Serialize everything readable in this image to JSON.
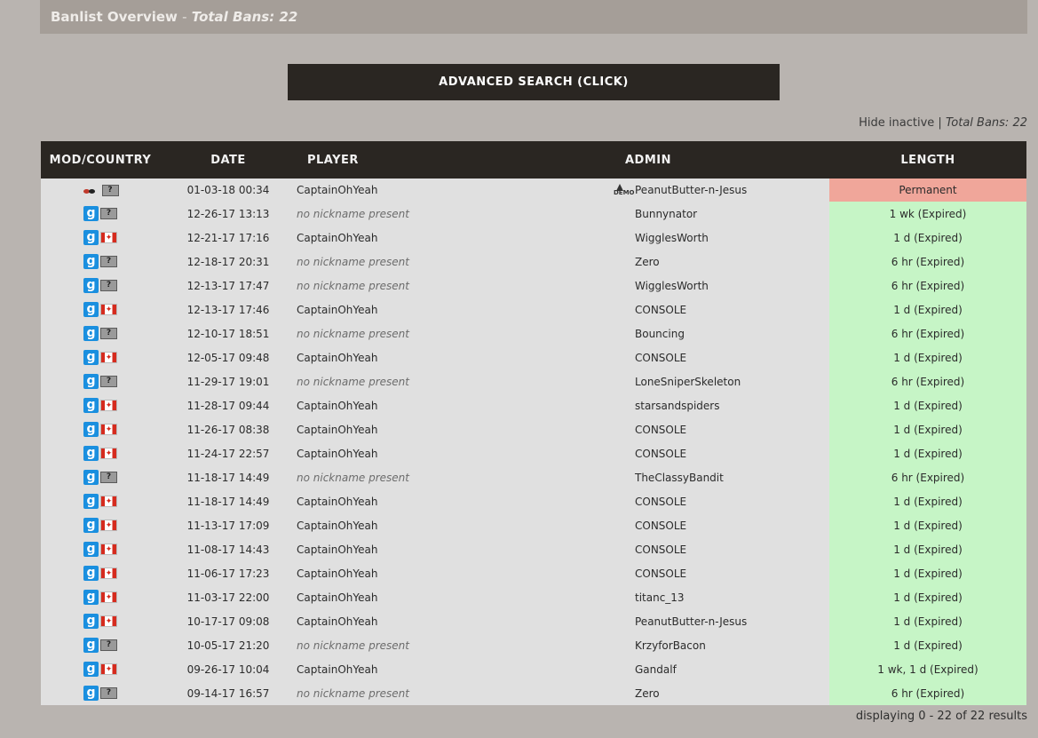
{
  "header": {
    "title": "Banlist Overview",
    "separator": "-",
    "total_label": "Total Bans: 22"
  },
  "advanced_search_label": "ADVANCED SEARCH (CLICK)",
  "filter": {
    "hide_inactive": "Hide inactive",
    "divider": "|",
    "total_label": "Total Bans: 22"
  },
  "columns": {
    "mod_country": "MOD/COUNTRY",
    "date": "DATE",
    "player": "PLAYER",
    "admin": "ADMIN",
    "length": "LENGTH"
  },
  "rows": [
    {
      "mod": "gamemode-icon",
      "country": "unknown",
      "date": "01-03-18 00:34",
      "player": "CaptainOhYeah",
      "admin": "PeanutButter-n-Jesus",
      "admin_icon": "demo-icon",
      "length": "Permanent",
      "status": "active"
    },
    {
      "mod": "gmod",
      "country": "unknown",
      "date": "12-26-17 13:13",
      "player": "no nickname present",
      "admin": "Bunnynator",
      "length": "1 wk (Expired)",
      "status": "expired"
    },
    {
      "mod": "gmod",
      "country": "canada",
      "date": "12-21-17 17:16",
      "player": "CaptainOhYeah",
      "admin": "WigglesWorth",
      "length": "1 d (Expired)",
      "status": "expired"
    },
    {
      "mod": "gmod",
      "country": "unknown",
      "date": "12-18-17 20:31",
      "player": "no nickname present",
      "admin": "Zero",
      "length": "6 hr (Expired)",
      "status": "expired"
    },
    {
      "mod": "gmod",
      "country": "unknown",
      "date": "12-13-17 17:47",
      "player": "no nickname present",
      "admin": "WigglesWorth",
      "length": "6 hr (Expired)",
      "status": "expired"
    },
    {
      "mod": "gmod",
      "country": "canada",
      "date": "12-13-17 17:46",
      "player": "CaptainOhYeah",
      "admin": "CONSOLE",
      "length": "1 d (Expired)",
      "status": "expired"
    },
    {
      "mod": "gmod",
      "country": "unknown",
      "date": "12-10-17 18:51",
      "player": "no nickname present",
      "admin": "Bouncing",
      "length": "6 hr (Expired)",
      "status": "expired"
    },
    {
      "mod": "gmod",
      "country": "canada",
      "date": "12-05-17 09:48",
      "player": "CaptainOhYeah",
      "admin": "CONSOLE",
      "length": "1 d (Expired)",
      "status": "expired"
    },
    {
      "mod": "gmod",
      "country": "unknown",
      "date": "11-29-17 19:01",
      "player": "no nickname present",
      "admin": "LoneSniperSkeleton",
      "length": "6 hr (Expired)",
      "status": "expired"
    },
    {
      "mod": "gmod",
      "country": "canada",
      "date": "11-28-17 09:44",
      "player": "CaptainOhYeah",
      "admin": "starsandspiders",
      "length": "1 d (Expired)",
      "status": "expired"
    },
    {
      "mod": "gmod",
      "country": "canada",
      "date": "11-26-17 08:38",
      "player": "CaptainOhYeah",
      "admin": "CONSOLE",
      "length": "1 d (Expired)",
      "status": "expired"
    },
    {
      "mod": "gmod",
      "country": "canada",
      "date": "11-24-17 22:57",
      "player": "CaptainOhYeah",
      "admin": "CONSOLE",
      "length": "1 d (Expired)",
      "status": "expired"
    },
    {
      "mod": "gmod",
      "country": "unknown",
      "date": "11-18-17 14:49",
      "player": "no nickname present",
      "admin": "TheClassyBandit",
      "length": "6 hr (Expired)",
      "status": "expired"
    },
    {
      "mod": "gmod",
      "country": "canada",
      "date": "11-18-17 14:49",
      "player": "CaptainOhYeah",
      "admin": "CONSOLE",
      "length": "1 d (Expired)",
      "status": "expired"
    },
    {
      "mod": "gmod",
      "country": "canada",
      "date": "11-13-17 17:09",
      "player": "CaptainOhYeah",
      "admin": "CONSOLE",
      "length": "1 d (Expired)",
      "status": "expired"
    },
    {
      "mod": "gmod",
      "country": "canada",
      "date": "11-08-17 14:43",
      "player": "CaptainOhYeah",
      "admin": "CONSOLE",
      "length": "1 d (Expired)",
      "status": "expired"
    },
    {
      "mod": "gmod",
      "country": "canada",
      "date": "11-06-17 17:23",
      "player": "CaptainOhYeah",
      "admin": "CONSOLE",
      "length": "1 d (Expired)",
      "status": "expired"
    },
    {
      "mod": "gmod",
      "country": "canada",
      "date": "11-03-17 22:00",
      "player": "CaptainOhYeah",
      "admin": "titanc_13",
      "length": "1 d (Expired)",
      "status": "expired"
    },
    {
      "mod": "gmod",
      "country": "canada",
      "date": "10-17-17 09:08",
      "player": "CaptainOhYeah",
      "admin": "PeanutButter-n-Jesus",
      "length": "1 d (Expired)",
      "status": "expired"
    },
    {
      "mod": "gmod",
      "country": "unknown",
      "date": "10-05-17 21:20",
      "player": "no nickname present",
      "admin": "KrzyforBacon",
      "length": "1 d (Expired)",
      "status": "expired"
    },
    {
      "mod": "gmod",
      "country": "canada",
      "date": "09-26-17 10:04",
      "player": "CaptainOhYeah",
      "admin": "Gandalf",
      "length": "1 wk, 1 d (Expired)",
      "status": "expired"
    },
    {
      "mod": "gmod",
      "country": "unknown",
      "date": "09-14-17 16:57",
      "player": "no nickname present",
      "admin": "Zero",
      "length": "6 hr (Expired)",
      "status": "expired"
    }
  ],
  "icons": {
    "gmod_glyph": "g",
    "unknown_glyph": "?",
    "flag_glyph": "✦",
    "demo_glyph": "DEMO"
  },
  "colors": {
    "header_bg": "#2a2622",
    "permanent": "#f0a69a",
    "expired": "#c6f5c6",
    "row_bg": "#e0e0e0"
  },
  "footer": "displaying 0 - 22 of 22 results"
}
